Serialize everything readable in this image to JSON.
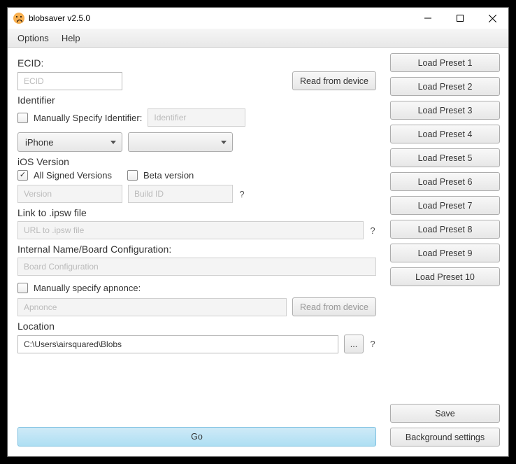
{
  "window": {
    "title": "blobsaver v2.5.0"
  },
  "menubar": {
    "options": "Options",
    "help": "Help"
  },
  "ecid": {
    "label": "ECID:",
    "placeholder": "ECID",
    "value": "",
    "read_btn": "Read from device"
  },
  "identifier": {
    "label": "Identifier",
    "manual_label": "Manually Specify Identifier:",
    "manual_checked": false,
    "manual_placeholder": "Identifier",
    "device_select": "iPhone",
    "model_select": ""
  },
  "ios": {
    "label": "iOS Version",
    "all_signed_label": "All Signed Versions",
    "all_signed_checked": true,
    "beta_label": "Beta version",
    "beta_checked": false,
    "version_placeholder": "Version",
    "build_placeholder": "Build ID"
  },
  "ipsw": {
    "label": "Link to .ipsw file",
    "placeholder": "URL to .ipsw file"
  },
  "board": {
    "label": "Internal Name/Board Configuration:",
    "placeholder": "Board Configuration"
  },
  "apnonce": {
    "manual_label": "Manually specify apnonce:",
    "manual_checked": false,
    "placeholder": "Apnonce",
    "read_btn": "Read from device"
  },
  "location": {
    "label": "Location",
    "value": "C:\\Users\\airsquared\\Blobs",
    "browse": "..."
  },
  "go": "Go",
  "presets": [
    "Load Preset 1",
    "Load Preset 2",
    "Load Preset 3",
    "Load Preset 4",
    "Load Preset 5",
    "Load Preset 6",
    "Load Preset 7",
    "Load Preset 8",
    "Load Preset 9",
    "Load Preset 10"
  ],
  "save": "Save",
  "bg_settings": "Background settings",
  "q": "?"
}
